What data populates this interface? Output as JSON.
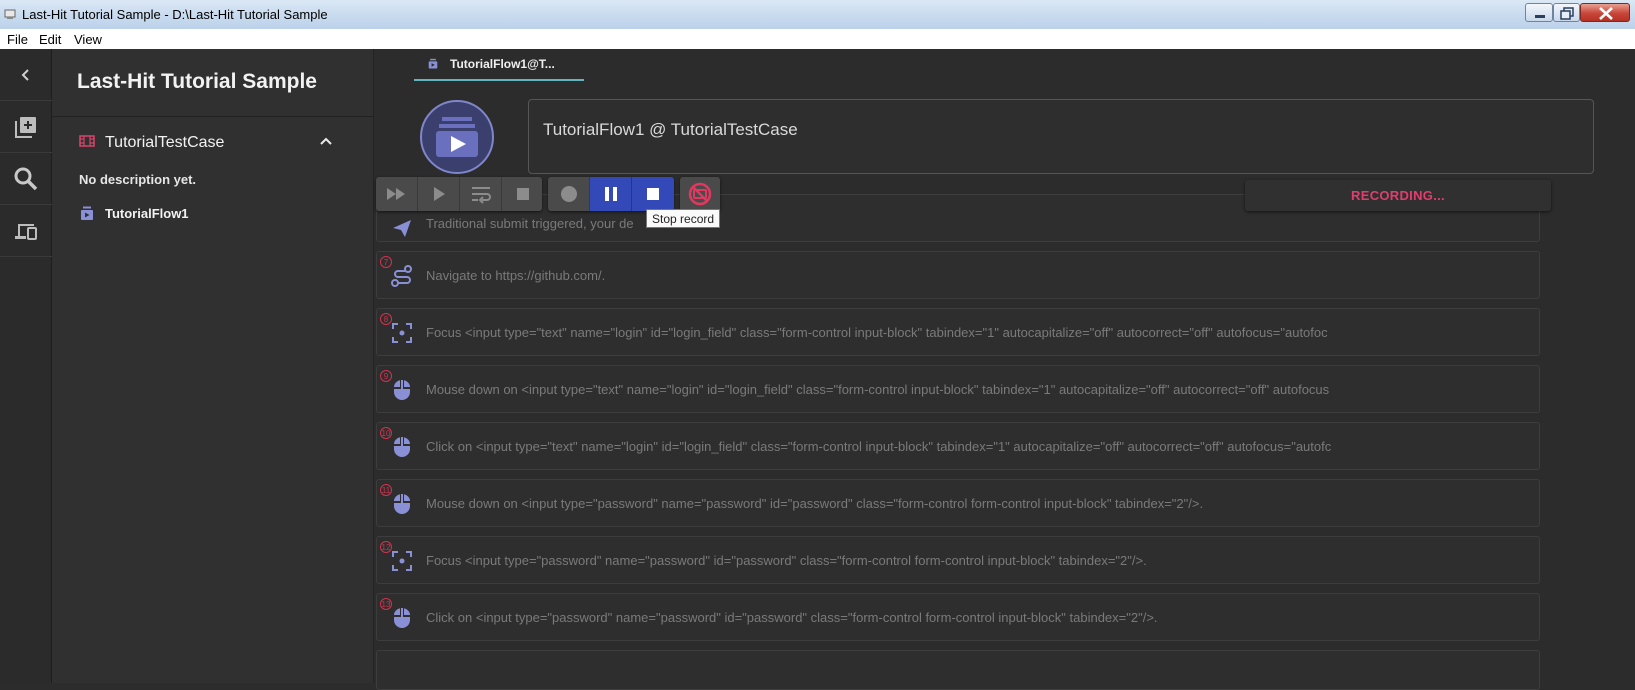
{
  "window": {
    "title": "Last-Hit Tutorial Sample - D:\\Last-Hit Tutorial Sample"
  },
  "menu": [
    "File",
    "Edit",
    "View"
  ],
  "sidebar": {
    "project_title": "Last-Hit Tutorial Sample",
    "test_case": "TutorialTestCase",
    "description": "No description yet.",
    "flow": "TutorialFlow1"
  },
  "tab": {
    "label": "TutorialFlow1@T..."
  },
  "header": {
    "title": "TutorialFlow1 @ TutorialTestCase"
  },
  "toolbar": {
    "tooltip": "Stop record",
    "status": "RECORDING..."
  },
  "steps": [
    {
      "num": "",
      "icon": "submit-icon",
      "text": "Traditional submit triggered, your de"
    },
    {
      "num": "7",
      "icon": "navigate-icon",
      "text": "Navigate to https://github.com/."
    },
    {
      "num": "8",
      "icon": "focus-icon",
      "text": "Focus <input type=\"text\" name=\"login\" id=\"login_field\" class=\"form-control input-block\" tabindex=\"1\" autocapitalize=\"off\" autocorrect=\"off\" autofocus=\"autofoc"
    },
    {
      "num": "9",
      "icon": "mouse-icon",
      "text": "Mouse down on <input type=\"text\" name=\"login\" id=\"login_field\" class=\"form-control input-block\" tabindex=\"1\" autocapitalize=\"off\" autocorrect=\"off\" autofocus"
    },
    {
      "num": "10",
      "icon": "mouse-icon",
      "text": "Click on <input type=\"text\" name=\"login\" id=\"login_field\" class=\"form-control input-block\" tabindex=\"1\" autocapitalize=\"off\" autocorrect=\"off\" autofocus=\"autofc"
    },
    {
      "num": "11",
      "icon": "mouse-icon",
      "text": "Mouse down on <input type=\"password\" name=\"password\" id=\"password\" class=\"form-control form-control input-block\" tabindex=\"2\"/>."
    },
    {
      "num": "12",
      "icon": "focus-icon",
      "text": "Focus <input type=\"password\" name=\"password\" id=\"password\" class=\"form-control form-control input-block\" tabindex=\"2\"/>."
    },
    {
      "num": "13",
      "icon": "mouse-icon",
      "text": "Click on <input type=\"password\" name=\"password\" id=\"password\" class=\"form-control form-control input-block\" tabindex=\"2\"/>."
    }
  ],
  "colors": {
    "accent": "#3349b8",
    "recording": "#e23d6e",
    "icon": "#8a90d6",
    "step_number": "#d3324f",
    "tab_underline": "#62b3bd"
  }
}
